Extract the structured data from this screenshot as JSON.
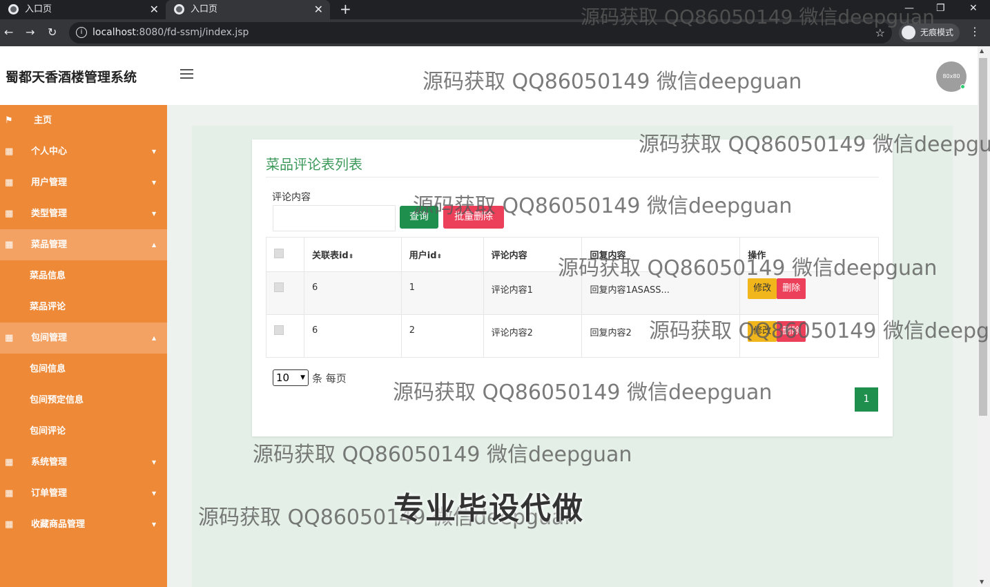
{
  "browser": {
    "tabs": [
      {
        "label": "入口页"
      },
      {
        "label": "入口页"
      }
    ],
    "url_host": "localhost",
    "url_rest": ":8080/fd-ssmj/index.jsp",
    "incognito_label": "无痕模式"
  },
  "app": {
    "title": "蜀都天香酒楼管理系统",
    "avatar_text": "80x80"
  },
  "sidebar": {
    "items": [
      {
        "label": "主页"
      },
      {
        "label": "个人中心"
      },
      {
        "label": "用户管理"
      },
      {
        "label": "类型管理"
      },
      {
        "label": "菜品管理"
      },
      {
        "label": "菜品信息"
      },
      {
        "label": "菜品评论"
      },
      {
        "label": "包间管理"
      },
      {
        "label": "包间信息"
      },
      {
        "label": "包间预定信息"
      },
      {
        "label": "包间评论"
      },
      {
        "label": "系统管理"
      },
      {
        "label": "订单管理"
      },
      {
        "label": "收藏商品管理"
      }
    ]
  },
  "main": {
    "title": "菜品评论表列表",
    "filter_label": "评论内容",
    "filter_value": "",
    "query_button": "查询",
    "bulk_delete_button": "批量删除",
    "columns": [
      "关联表id",
      "用户id",
      "评论内容",
      "回复内容",
      "操作"
    ],
    "rows": [
      {
        "ref_id": "6",
        "user_id": "1",
        "comment": "评论内容1",
        "reply": "回复内容1ASASS..."
      },
      {
        "ref_id": "6",
        "user_id": "2",
        "comment": "评论内容2",
        "reply": "回复内容2"
      }
    ],
    "edit_label": "修改",
    "delete_label": "删除",
    "page_size": "10",
    "page_size_suffix": "条 每页",
    "current_page": "1"
  },
  "watermark": {
    "text": "源码获取 QQ86050149 微信deepguan",
    "big_text": "专业毕设代做"
  },
  "colors": {
    "sidebar": "#ed8937",
    "accent_green": "#1f8f4e",
    "danger": "#ec3f5a",
    "warning": "#f2b61d"
  }
}
